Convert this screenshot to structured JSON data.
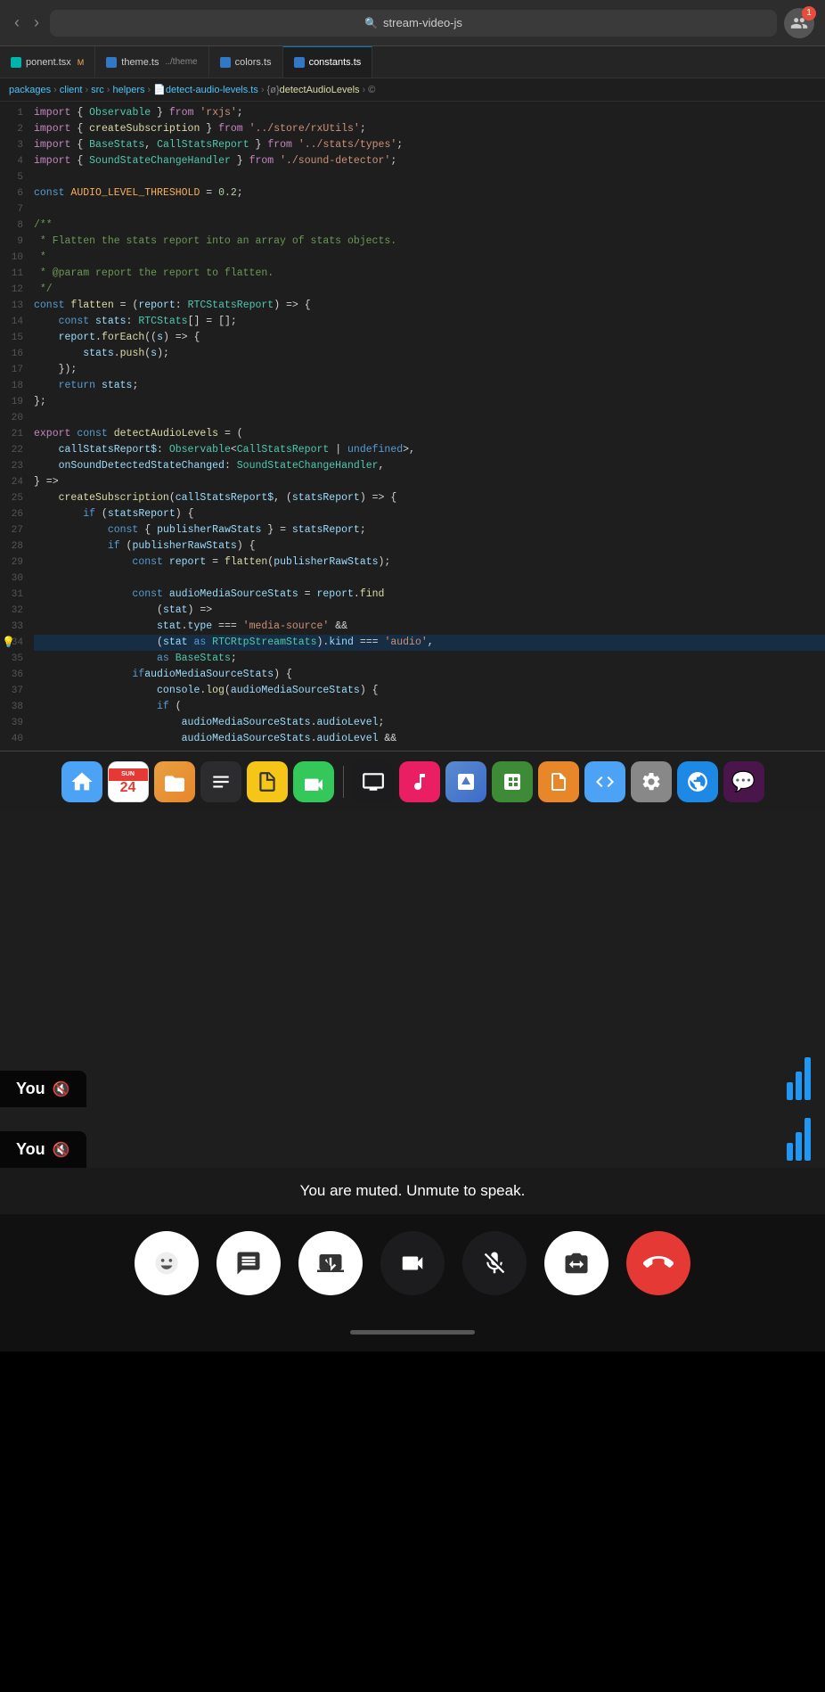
{
  "browser": {
    "back_icon": "‹",
    "forward_icon": "›",
    "url": "stream-video-js",
    "search_icon": "🔍",
    "avatar_icon": "👥",
    "badge_count": "1"
  },
  "tabs": [
    {
      "id": "component",
      "label": "ponent.tsx",
      "suffix": "M",
      "type": "tsx",
      "active": false
    },
    {
      "id": "theme",
      "label": "theme.ts",
      "suffix": "../theme",
      "type": "ts",
      "active": false
    },
    {
      "id": "colors",
      "label": "colors.ts",
      "suffix": "",
      "type": "ts",
      "active": false
    },
    {
      "id": "constants",
      "label": "constants.ts",
      "suffix": "",
      "type": "ts",
      "active": false
    }
  ],
  "breadcrumb": "packages > client > src > helpers > detect-audio-levels.ts > {ø} detectAudioLevels > ©",
  "code_lines": [
    {
      "num": "1",
      "tokens": [
        {
          "t": "kw2",
          "v": "import"
        },
        {
          "t": "op",
          "v": " { "
        },
        {
          "t": "type",
          "v": "Observable"
        },
        {
          "t": "op",
          "v": " } "
        },
        {
          "t": "kw2",
          "v": "from"
        },
        {
          "t": "str",
          "v": " 'rxjs'"
        },
        {
          "t": "op",
          "v": ";"
        }
      ]
    },
    {
      "num": "2",
      "tokens": [
        {
          "t": "kw2",
          "v": "import"
        },
        {
          "t": "op",
          "v": " { "
        },
        {
          "t": "fn",
          "v": "createSubscription"
        },
        {
          "t": "op",
          "v": " } "
        },
        {
          "t": "kw2",
          "v": "from"
        },
        {
          "t": "str",
          "v": " '../store/rxUtils'"
        },
        {
          "t": "op",
          "v": ";"
        }
      ]
    },
    {
      "num": "3",
      "tokens": [
        {
          "t": "kw2",
          "v": "import"
        },
        {
          "t": "op",
          "v": " { "
        },
        {
          "t": "type",
          "v": "BaseStats"
        },
        {
          "t": "op",
          "v": ", "
        },
        {
          "t": "type",
          "v": "CallStatsReport"
        },
        {
          "t": "op",
          "v": " } "
        },
        {
          "t": "kw2",
          "v": "from"
        },
        {
          "t": "str",
          "v": " '../stats/types'"
        },
        {
          "t": "op",
          "v": ";"
        }
      ]
    },
    {
      "num": "4",
      "tokens": [
        {
          "t": "kw2",
          "v": "import"
        },
        {
          "t": "op",
          "v": " { "
        },
        {
          "t": "type",
          "v": "SoundStateChangeHandler"
        },
        {
          "t": "op",
          "v": " } "
        },
        {
          "t": "kw2",
          "v": "from"
        },
        {
          "t": "str",
          "v": " './sound-detector'"
        },
        {
          "t": "op",
          "v": ";"
        }
      ]
    },
    {
      "num": "5",
      "tokens": []
    },
    {
      "num": "6",
      "tokens": [
        {
          "t": "kw",
          "v": "const"
        },
        {
          "t": "op",
          "v": " "
        },
        {
          "t": "const-name",
          "v": "AUDIO_LEVEL_THRESHOLD"
        },
        {
          "t": "op",
          "v": " = "
        },
        {
          "t": "num",
          "v": "0.2"
        },
        {
          "t": "op",
          "v": ";"
        }
      ]
    },
    {
      "num": "7",
      "tokens": []
    },
    {
      "num": "8",
      "tokens": [
        {
          "t": "cmt",
          "v": "/**"
        }
      ]
    },
    {
      "num": "9",
      "tokens": [
        {
          "t": "cmt",
          "v": " * Flatten the stats report into an array of stats objects."
        }
      ]
    },
    {
      "num": "10",
      "tokens": [
        {
          "t": "cmt",
          "v": " *"
        }
      ]
    },
    {
      "num": "11",
      "tokens": [
        {
          "t": "cmt",
          "v": " * @param report the report to flatten."
        }
      ]
    },
    {
      "num": "12",
      "tokens": [
        {
          "t": "cmt",
          "v": " */"
        }
      ]
    },
    {
      "num": "13",
      "tokens": [
        {
          "t": "kw",
          "v": "const"
        },
        {
          "t": "op",
          "v": " "
        },
        {
          "t": "fn",
          "v": "flatten"
        },
        {
          "t": "op",
          "v": " = ("
        },
        {
          "t": "param",
          "v": "report"
        },
        {
          "t": "op",
          "v": ": "
        },
        {
          "t": "type",
          "v": "RTCStatsReport"
        },
        {
          "t": "op",
          "v": ") => {"
        }
      ]
    },
    {
      "num": "14",
      "tokens": [
        {
          "t": "op",
          "v": "    "
        },
        {
          "t": "kw",
          "v": "const"
        },
        {
          "t": "op",
          "v": " "
        },
        {
          "t": "param",
          "v": "stats"
        },
        {
          "t": "op",
          "v": ": "
        },
        {
          "t": "type",
          "v": "RTCStats"
        },
        {
          "t": "op",
          "v": "[] = [];"
        }
      ]
    },
    {
      "num": "15",
      "tokens": [
        {
          "t": "op",
          "v": "    "
        },
        {
          "t": "param",
          "v": "report"
        },
        {
          "t": "op",
          "v": "."
        },
        {
          "t": "fn",
          "v": "forEach"
        },
        {
          "t": "op",
          "v": "(("
        },
        {
          "t": "param",
          "v": "s"
        },
        {
          "t": "op",
          "v": ") => {"
        }
      ]
    },
    {
      "num": "16",
      "tokens": [
        {
          "t": "op",
          "v": "        "
        },
        {
          "t": "param",
          "v": "stats"
        },
        {
          "t": "op",
          "v": "."
        },
        {
          "t": "fn",
          "v": "push"
        },
        {
          "t": "op",
          "v": "("
        },
        {
          "t": "param",
          "v": "s"
        },
        {
          "t": "op",
          "v": ");"
        }
      ]
    },
    {
      "num": "17",
      "tokens": [
        {
          "t": "op",
          "v": "    });"
        }
      ]
    },
    {
      "num": "18",
      "tokens": [
        {
          "t": "op",
          "v": "    "
        },
        {
          "t": "kw",
          "v": "return"
        },
        {
          "t": "op",
          "v": " "
        },
        {
          "t": "param",
          "v": "stats"
        },
        {
          "t": "op",
          "v": ";"
        }
      ]
    },
    {
      "num": "19",
      "tokens": [
        {
          "t": "op",
          "v": "};"
        }
      ]
    },
    {
      "num": "20",
      "tokens": []
    },
    {
      "num": "21",
      "tokens": [
        {
          "t": "kw2",
          "v": "export"
        },
        {
          "t": "op",
          "v": " "
        },
        {
          "t": "kw",
          "v": "const"
        },
        {
          "t": "op",
          "v": " "
        },
        {
          "t": "fn",
          "v": "detectAudioLevels"
        },
        {
          "t": "op",
          "v": " = ("
        }
      ]
    },
    {
      "num": "22",
      "tokens": [
        {
          "t": "op",
          "v": "    "
        },
        {
          "t": "param",
          "v": "callStatsReport$"
        },
        {
          "t": "op",
          "v": ": "
        },
        {
          "t": "type",
          "v": "Observable"
        },
        {
          "t": "op",
          "v": "<"
        },
        {
          "t": "type",
          "v": "CallStatsReport"
        },
        {
          "t": "op",
          "v": " | "
        },
        {
          "t": "kw",
          "v": "undefined"
        },
        {
          "t": "op",
          "v": ">,"
        }
      ]
    },
    {
      "num": "23",
      "tokens": [
        {
          "t": "op",
          "v": "    "
        },
        {
          "t": "param",
          "v": "onSoundDetectedStateChanged"
        },
        {
          "t": "op",
          "v": ": "
        },
        {
          "t": "type",
          "v": "SoundStateChangeHandler"
        },
        {
          "t": "op",
          "v": ","
        }
      ]
    },
    {
      "num": "24",
      "tokens": [
        {
          "t": "op",
          "v": "} =>"
        }
      ]
    },
    {
      "num": "25",
      "tokens": [
        {
          "t": "op",
          "v": "    "
        },
        {
          "t": "fn",
          "v": "createSubscription"
        },
        {
          "t": "op",
          "v": "("
        },
        {
          "t": "param",
          "v": "callStatsReport$"
        },
        {
          "t": "op",
          "v": ", ("
        },
        {
          "t": "param",
          "v": "statsReport"
        },
        {
          "t": "op",
          "v": ") => {"
        }
      ]
    },
    {
      "num": "26",
      "tokens": [
        {
          "t": "op",
          "v": "        "
        },
        {
          "t": "kw",
          "v": "if"
        },
        {
          "t": "op",
          "v": " ("
        },
        {
          "t": "param",
          "v": "statsReport"
        },
        {
          "t": "op",
          "v": ") {"
        }
      ]
    },
    {
      "num": "27",
      "tokens": [
        {
          "t": "op",
          "v": "            "
        },
        {
          "t": "kw",
          "v": "const"
        },
        {
          "t": "op",
          "v": " { "
        },
        {
          "t": "param",
          "v": "publisherRawStats"
        },
        {
          "t": "op",
          "v": " } = "
        },
        {
          "t": "param",
          "v": "statsReport"
        },
        {
          "t": "op",
          "v": ";"
        }
      ]
    },
    {
      "num": "28",
      "tokens": [
        {
          "t": "op",
          "v": "            "
        },
        {
          "t": "kw",
          "v": "if"
        },
        {
          "t": "op",
          "v": " ("
        },
        {
          "t": "param",
          "v": "publisherRawStats"
        },
        {
          "t": "op",
          "v": ") {"
        }
      ]
    },
    {
      "num": "29",
      "tokens": [
        {
          "t": "op",
          "v": "                "
        },
        {
          "t": "kw",
          "v": "const"
        },
        {
          "t": "op",
          "v": " "
        },
        {
          "t": "param",
          "v": "report"
        },
        {
          "t": "op",
          "v": " = "
        },
        {
          "t": "fn",
          "v": "flatten"
        },
        {
          "t": "op",
          "v": "("
        },
        {
          "t": "param",
          "v": "publisherRawStats"
        },
        {
          "t": "op",
          "v": ");"
        }
      ]
    },
    {
      "num": "30",
      "tokens": []
    },
    {
      "num": "31",
      "tokens": [
        {
          "t": "op",
          "v": "                "
        },
        {
          "t": "kw",
          "v": "const"
        },
        {
          "t": "op",
          "v": " "
        },
        {
          "t": "param",
          "v": "audioMediaSourceStats"
        },
        {
          "t": "op",
          "v": " = "
        },
        {
          "t": "param",
          "v": "report"
        },
        {
          "t": "op",
          "v": "."
        },
        {
          "t": "fn",
          "v": "find"
        }
      ]
    },
    {
      "num": "32",
      "tokens": [
        {
          "t": "op",
          "v": "                    ("
        },
        {
          "t": "param",
          "v": "stat"
        },
        {
          "t": "op",
          "v": ") =>"
        }
      ]
    },
    {
      "num": "33",
      "tokens": [
        {
          "t": "op",
          "v": "                    "
        },
        {
          "t": "param",
          "v": "stat"
        },
        {
          "t": "op",
          "v": "."
        },
        {
          "t": "prop",
          "v": "type"
        },
        {
          "t": "op",
          "v": " === "
        },
        {
          "t": "str",
          "v": "'media-source'"
        },
        {
          "t": "op",
          "v": " &&"
        }
      ]
    },
    {
      "num": "34",
      "tokens": [
        {
          "t": "op",
          "v": "                    ("
        },
        {
          "t": "param",
          "v": "stat"
        },
        {
          "t": "op",
          "v": " "
        },
        {
          "t": "kw",
          "v": "as"
        },
        {
          "t": "op",
          "v": " "
        },
        {
          "t": "type",
          "v": "RTCRtpStreamStats"
        },
        {
          "t": "op",
          "v": ")."
        },
        {
          "t": "prop",
          "v": "kind"
        },
        {
          "t": "op",
          "v": " === "
        },
        {
          "t": "str",
          "v": "'audio'"
        },
        {
          "t": "op",
          "v": ","
        }
      ],
      "highlight": true
    },
    {
      "num": "35",
      "tokens": [
        {
          "t": "op",
          "v": "                    "
        },
        {
          "t": "kw",
          "v": "as"
        },
        {
          "t": "op",
          "v": " "
        },
        {
          "t": "type",
          "v": "BaseStats"
        },
        {
          "t": "op",
          "v": ";"
        }
      ]
    },
    {
      "num": "36",
      "tokens": [
        {
          "t": "op",
          "v": "                "
        },
        {
          "t": "kw",
          "v": "if"
        },
        {
          "t": "op",
          " v": "("
        },
        {
          "t": "param",
          "v": "audioMediaSourceStats"
        },
        {
          "t": "op",
          "v": ") {"
        }
      ]
    },
    {
      "num": "37",
      "tokens": [
        {
          "t": "op",
          "v": "                    "
        },
        {
          "t": "param",
          "v": "console"
        },
        {
          "t": "op",
          "v": "."
        },
        {
          "t": "fn",
          "v": "log"
        },
        {
          "t": "op",
          "v": "("
        },
        {
          "t": "param",
          "v": "audioMediaSourceStats"
        },
        {
          "t": "op",
          "v": ") {"
        }
      ]
    },
    {
      "num": "38",
      "tokens": [
        {
          "t": "op",
          "v": "                    "
        },
        {
          "t": "kw",
          "v": "if"
        },
        {
          "t": "op",
          "v": " ("
        }
      ]
    },
    {
      "num": "39",
      "tokens": [
        {
          "t": "op",
          "v": "                        "
        },
        {
          "t": "param",
          "v": "audioMediaSourceStats"
        },
        {
          "t": "op",
          "v": "."
        },
        {
          "t": "prop",
          "v": "audioLevel"
        },
        {
          "t": "op",
          "v": ";"
        }
      ]
    },
    {
      "num": "40",
      "tokens": [
        {
          "t": "op",
          "v": "                        "
        },
        {
          "t": "param",
          "v": "audioMediaSourceStats"
        },
        {
          "t": "op",
          "v": "."
        },
        {
          "t": "prop",
          "v": "audioLevel"
        },
        {
          "t": "op",
          "v": " &&"
        }
      ]
    }
  ],
  "dock_icons": [
    {
      "id": "finder",
      "bg": "#4ca3f5",
      "emoji": "🟦",
      "label": "Finder"
    },
    {
      "id": "calendar",
      "bg": "#e53935",
      "emoji": "📅",
      "label": "Calendar",
      "badge": "24"
    },
    {
      "id": "folder",
      "bg": "#e8862a",
      "emoji": "📁",
      "label": "Folder"
    },
    {
      "id": "reminders",
      "bg": "#4a4a4a",
      "emoji": "☰",
      "label": "Reminders"
    },
    {
      "id": "notes",
      "bg": "#f5c518",
      "emoji": "📝",
      "label": "Notes"
    },
    {
      "id": "facetime",
      "bg": "#4a4a4a",
      "emoji": "📹",
      "label": "FaceTime"
    },
    {
      "id": "tv",
      "bg": "#1c1c1c",
      "emoji": "📺",
      "label": "TV"
    },
    {
      "id": "music",
      "bg": "#e91e63",
      "emoji": "🎵",
      "label": "Music"
    },
    {
      "id": "keynote",
      "bg": "#3c6bc8",
      "emoji": "📊",
      "label": "Keynote"
    },
    {
      "id": "numbers",
      "bg": "#3d8b37",
      "emoji": "📈",
      "label": "Numbers"
    },
    {
      "id": "pages",
      "bg": "#e8862a",
      "emoji": "📄",
      "label": "Pages"
    },
    {
      "id": "xcode",
      "bg": "#4ca3f5",
      "emoji": "⚙️",
      "label": "Xcode"
    },
    {
      "id": "system-prefs",
      "bg": "#888",
      "emoji": "⚙️",
      "label": "System Preferences"
    },
    {
      "id": "edge",
      "bg": "#1e88e5",
      "emoji": "🌐",
      "label": "Edge"
    },
    {
      "id": "slack",
      "bg": "#4a154b",
      "emoji": "💬",
      "label": "Slack"
    }
  ],
  "you_label": "You",
  "mute_icon": "🔇",
  "audio_bars": [
    20,
    32,
    48
  ],
  "mute_status_text": "You are muted. Unmute to speak.",
  "call_controls": [
    {
      "id": "reaction",
      "emoji": "😊",
      "style": "light",
      "label": "Reaction"
    },
    {
      "id": "chat",
      "emoji": "💬",
      "style": "light",
      "label": "Chat"
    },
    {
      "id": "share-screen",
      "emoji": "⬆",
      "style": "light",
      "label": "Share Screen"
    },
    {
      "id": "camera",
      "emoji": "📷",
      "style": "dark",
      "label": "Camera"
    },
    {
      "id": "mute",
      "emoji": "🎤",
      "style": "muted",
      "label": "Mute"
    },
    {
      "id": "flip-camera",
      "emoji": "🔄",
      "style": "light",
      "label": "Flip Camera"
    },
    {
      "id": "end-call",
      "emoji": "📞",
      "style": "red",
      "label": "End Call"
    }
  ]
}
